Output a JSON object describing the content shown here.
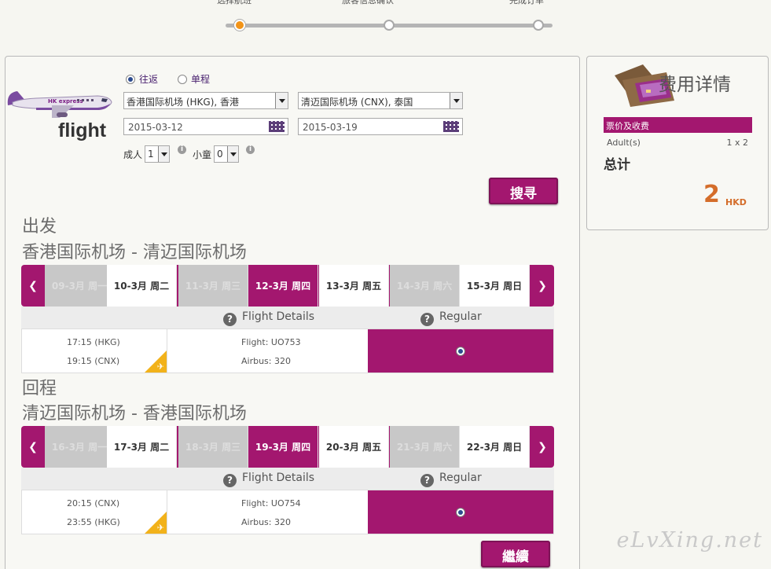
{
  "progress": {
    "steps": [
      "选择航班",
      "旅客信息确认",
      "完成订单"
    ],
    "current_step": 1
  },
  "brand": {
    "word": "flight",
    "plane_livery": "HK express"
  },
  "trip_type": {
    "roundtrip_label": "往返",
    "oneway_label": "单程",
    "selected": "roundtrip"
  },
  "search": {
    "origin": "香港国际机场 (HKG), 香港",
    "destination": "清迈国际机场 (CNX), 泰国",
    "depart_date": "2015-03-12",
    "return_date": "2015-03-19",
    "adult_label": "成人",
    "adult_count": "1",
    "child_label": "小童",
    "child_count": "0",
    "button_label": "搜寻"
  },
  "outbound": {
    "heading": "出发",
    "route": "香港国际机场 - 清迈国际机场",
    "dates": [
      {
        "label": "09-3月 周一",
        "state": "grey"
      },
      {
        "label": "10-3月 周二",
        "state": "white"
      },
      {
        "label": "11-3月 周三",
        "state": "grey"
      },
      {
        "label": "12-3月 周四",
        "state": "sel"
      },
      {
        "label": "13-3月 周五",
        "state": "white"
      },
      {
        "label": "14-3月 周六",
        "state": "grey"
      },
      {
        "label": "15-3月 周日",
        "state": "white"
      }
    ],
    "details_label": "Flight Details",
    "fare_label": "Regular",
    "depart_time": "17:15 (HKG)",
    "arrive_time": "19:15 (CNX)",
    "flight_no": "Flight: UO753",
    "aircraft": "Airbus: 320"
  },
  "inbound": {
    "heading": "回程",
    "route": "清迈国际机场 - 香港国际机场",
    "dates": [
      {
        "label": "16-3月 周一",
        "state": "grey"
      },
      {
        "label": "17-3月 周二",
        "state": "white"
      },
      {
        "label": "18-3月 周三",
        "state": "grey"
      },
      {
        "label": "19-3月 周四",
        "state": "sel"
      },
      {
        "label": "20-3月 周五",
        "state": "white"
      },
      {
        "label": "21-3月 周六",
        "state": "grey"
      },
      {
        "label": "22-3月 周日",
        "state": "white"
      }
    ],
    "details_label": "Flight Details",
    "fare_label": "Regular",
    "depart_time": "20:15 (CNX)",
    "arrive_time": "23:55 (HKG)",
    "flight_no": "Flight: UO754",
    "aircraft": "Airbus: 320"
  },
  "continue_label": "繼續",
  "fees": {
    "title": "费用详情",
    "section_label": "票价及收费",
    "adult_label": "Adult(s)",
    "adult_qty": "1 x 2",
    "total_label": "总计",
    "total_amount": "2",
    "currency": "HKD"
  },
  "watermark": "eLvXing.net",
  "colors": {
    "accent": "#a3176f",
    "progress_active": "#f29418",
    "total": "#d46d2a",
    "badge": "#f2b21a"
  }
}
